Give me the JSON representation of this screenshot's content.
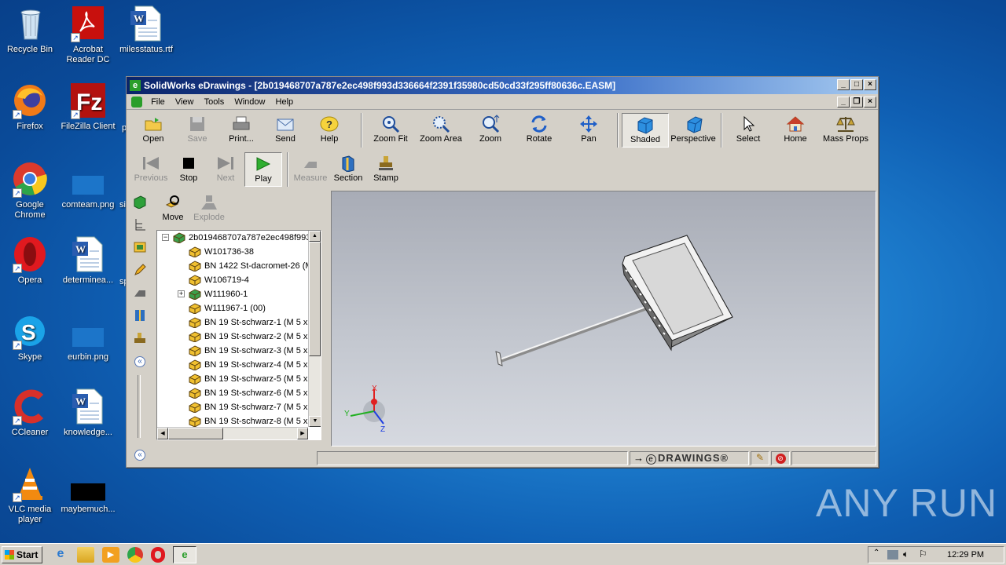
{
  "desktop": {
    "icons": [
      {
        "label": "Recycle Bin",
        "icon": "recycle-bin-icon"
      },
      {
        "label": "Acrobat Reader DC",
        "icon": "acrobat-icon"
      },
      {
        "label": "milesstatus.rtf",
        "icon": "word-doc-icon"
      },
      {
        "label": "Firefox",
        "icon": "firefox-icon"
      },
      {
        "label": "FileZilla Client",
        "icon": "filezilla-icon"
      },
      {
        "label": "Google Chrome",
        "icon": "chrome-icon"
      },
      {
        "label": "comteam.png",
        "icon": "image-file-icon"
      },
      {
        "label": "Opera",
        "icon": "opera-icon"
      },
      {
        "label": "determinea...",
        "icon": "word-doc-icon"
      },
      {
        "label": "Skype",
        "icon": "skype-icon"
      },
      {
        "label": "eurbin.png",
        "icon": "image-file-icon"
      },
      {
        "label": "CCleaner",
        "icon": "ccleaner-icon"
      },
      {
        "label": "knowledge...",
        "icon": "word-doc-icon"
      },
      {
        "label": "VLC media player",
        "icon": "vlc-icon"
      },
      {
        "label": "maybemuch...",
        "icon": "black-image-icon"
      }
    ],
    "partial_labels": [
      "p",
      "si",
      "sp"
    ],
    "watermark": "ANY RUN"
  },
  "window": {
    "title": "SolidWorks eDrawings - [2b019468707a787e2ec498f993d336664f2391f35980cd50cd33f295ff80636c.EASM]",
    "menu": [
      "File",
      "View",
      "Tools",
      "Window",
      "Help"
    ],
    "toolbar1": [
      {
        "label": "Open",
        "icon": "open-folder-icon",
        "enabled": true
      },
      {
        "label": "Save",
        "icon": "save-icon",
        "enabled": false
      },
      {
        "label": "Print...",
        "icon": "print-icon",
        "enabled": true
      },
      {
        "label": "Send",
        "icon": "send-mail-icon",
        "enabled": true
      },
      {
        "label": "Help",
        "icon": "help-icon",
        "enabled": true
      }
    ],
    "toolbar2": [
      {
        "label": "Zoom Fit",
        "icon": "zoom-fit-icon"
      },
      {
        "label": "Zoom Area",
        "icon": "zoom-area-icon"
      },
      {
        "label": "Zoom",
        "icon": "zoom-icon"
      },
      {
        "label": "Rotate",
        "icon": "rotate-icon"
      },
      {
        "label": "Pan",
        "icon": "pan-icon"
      }
    ],
    "toolbar3": [
      {
        "label": "Shaded",
        "icon": "shaded-cube-icon",
        "active": true
      },
      {
        "label": "Perspective",
        "icon": "perspective-cube-icon",
        "active": false
      }
    ],
    "toolbar4": [
      {
        "label": "Select",
        "icon": "select-arrow-icon"
      },
      {
        "label": "Home",
        "icon": "home-icon"
      },
      {
        "label": "Mass Props",
        "icon": "mass-props-icon"
      }
    ],
    "playback": [
      {
        "label": "Previous",
        "icon": "previous-icon",
        "enabled": false
      },
      {
        "label": "Stop",
        "icon": "stop-icon",
        "enabled": true
      },
      {
        "label": "Next",
        "icon": "next-icon",
        "enabled": false
      },
      {
        "label": "Play",
        "icon": "play-icon",
        "enabled": true,
        "active": true
      }
    ],
    "tools2": [
      {
        "label": "Measure",
        "icon": "measure-icon",
        "enabled": false
      },
      {
        "label": "Section",
        "icon": "section-icon",
        "enabled": true
      },
      {
        "label": "Stamp",
        "icon": "stamp-icon",
        "enabled": true
      }
    ],
    "panel_tools": [
      {
        "label": "Move",
        "icon": "move-icon",
        "enabled": true
      },
      {
        "label": "Explode",
        "icon": "explode-icon",
        "enabled": false
      }
    ],
    "tree": [
      {
        "label": "2b019468707a787e2ec498f993",
        "expander": "−",
        "root": true
      },
      {
        "label": "W101736-38",
        "expander": ""
      },
      {
        "label": "BN 1422 St-dacromet-26 (M",
        "expander": ""
      },
      {
        "label": "W106719-4",
        "expander": ""
      },
      {
        "label": "W111960-1",
        "expander": "+"
      },
      {
        "label": "W111967-1 (00)",
        "expander": ""
      },
      {
        "label": "BN 19 St-schwarz-1 (M 5 x",
        "expander": ""
      },
      {
        "label": "BN 19 St-schwarz-2 (M 5 x",
        "expander": ""
      },
      {
        "label": "BN 19 St-schwarz-3 (M 5 x",
        "expander": ""
      },
      {
        "label": "BN 19 St-schwarz-4 (M 5 x",
        "expander": ""
      },
      {
        "label": "BN 19 St-schwarz-5 (M 5 x",
        "expander": ""
      },
      {
        "label": "BN 19 St-schwarz-6 (M 5 x",
        "expander": ""
      },
      {
        "label": "BN 19 St-schwarz-7 (M 5 x",
        "expander": ""
      },
      {
        "label": "BN 19 St-schwarz-8 (M 5 x",
        "expander": ""
      }
    ],
    "axes": {
      "x": "X",
      "y": "Y",
      "z": "Z"
    },
    "status_logo": "DRAWINGS®"
  },
  "taskbar": {
    "start": "Start",
    "clock": "12:29 PM"
  },
  "colors": {
    "titlebar": "#0a246a",
    "accent_blue": "#1e7fcf"
  }
}
